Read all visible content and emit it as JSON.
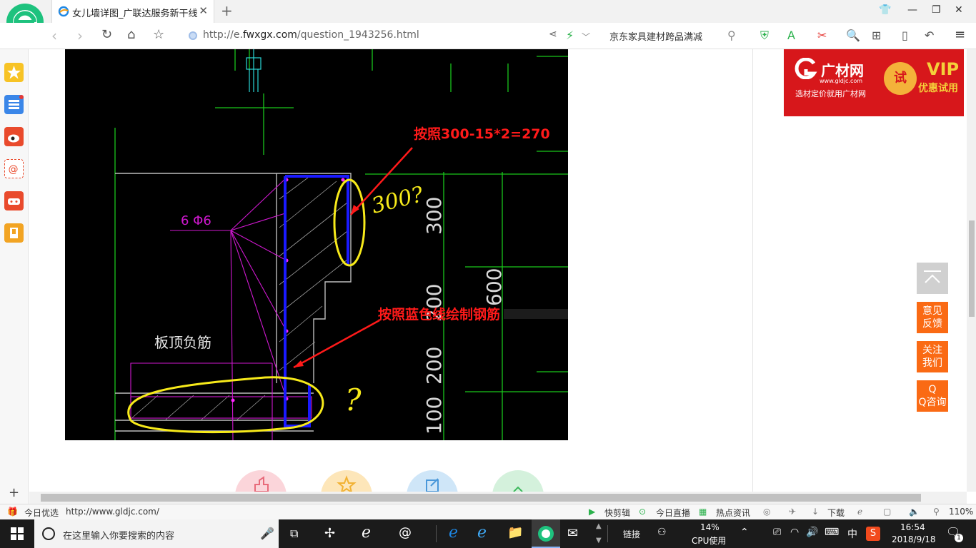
{
  "browser": {
    "tab_title": "女儿墙详图_广联达服务新干线",
    "url_prefix": "http://e.",
    "url_host": "fwxgx.com",
    "url_path": "/question_1943256.html",
    "search_text": "京东家具建材跨品满减"
  },
  "cad": {
    "rebar_label": "6 Φ6",
    "board_label": "板顶负筋",
    "annotation_top": "按照300-15*2=270",
    "annotation_mid": "按照蓝色线绘制钢筋",
    "handwritten_q1": "300?",
    "handwritten_q2": "?",
    "dims": [
      "300",
      "600",
      "200",
      "200",
      "100"
    ],
    "colors": {
      "blue_outline": "#1a1aff",
      "yellow_mark": "#f7ea1a",
      "red_text": "#ff1a1a",
      "green_line": "#19c61b",
      "magenta": "#d018d0"
    }
  },
  "ad": {
    "brand": "广材网",
    "url": "www.gldjc.com",
    "slogan": "选材定价就用广材网",
    "badge": "试",
    "vip": "VIP",
    "offer": "优惠试用"
  },
  "side_buttons": {
    "feedback": "意见反馈",
    "follow": "关注我们",
    "qq": "Q Q咨询"
  },
  "statusbar": {
    "left_label": "今日优选",
    "link_url": "http://www.gldjc.com/",
    "quick_clip": "快剪辑",
    "live": "今日直播",
    "news": "热点资讯",
    "download": "下载",
    "zoom": "110%"
  },
  "taskbar": {
    "search_placeholder": "在这里输入你要搜索的内容",
    "links": "链接",
    "cpu_percent": "14%",
    "cpu_label": "CPU使用",
    "ime": "中",
    "time": "16:54",
    "date": "2018/9/18",
    "notif_count": "1"
  }
}
